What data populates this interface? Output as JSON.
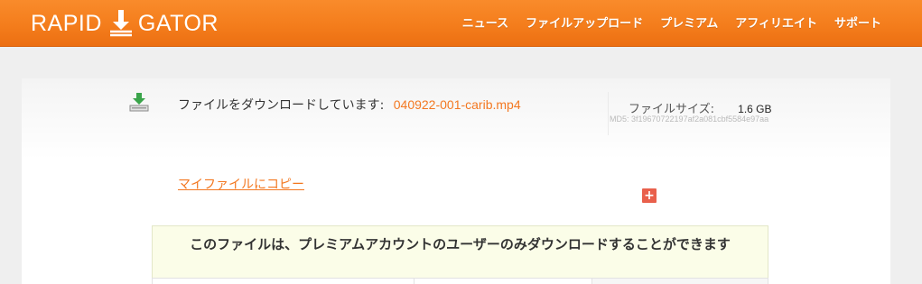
{
  "header": {
    "logo_left": "RAPID",
    "logo_right": "GATOR",
    "nav": [
      "ニュース",
      "ファイルアップロード",
      "プレミアム",
      "アフィリエイト",
      "サポート"
    ]
  },
  "download": {
    "label": "ファイルをダウンロードしています:",
    "filename": "040922-001-carib.mp4",
    "size_label": "ファイルサイズ:",
    "size_value": "1.6 GB",
    "md5": "MD5: 3f19670722197af2a081cbf5584e97aa",
    "copy_link": "マイファイルにコピー",
    "plus": "+"
  },
  "notice": {
    "text": "このファイルは、プレミアムアカウントのユーザーのみダウンロードすることができます"
  },
  "colors": {
    "header": "#f47d1c",
    "accent": "#f37821",
    "plus_button": "#e9604c",
    "notice_bg": "#fbfde8"
  },
  "icons": [
    "download-arrow-icon",
    "download-tray-icon",
    "plus-icon"
  ]
}
